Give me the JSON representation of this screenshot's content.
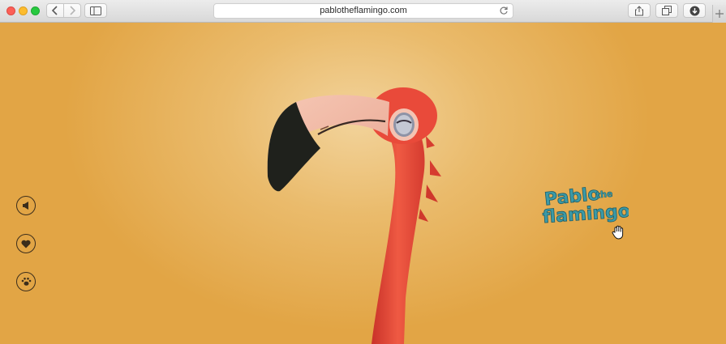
{
  "browser": {
    "url": "pablotheflamingo.com",
    "buttons": {
      "back": "back-icon",
      "forward": "forward-icon",
      "sidebar": "sidebar-icon",
      "reload": "reload-icon",
      "share": "share-icon",
      "tabs": "tabs-icon",
      "downloads": "download-icon",
      "new_tab": "plus-icon"
    }
  },
  "page": {
    "logo": {
      "line1": "Pablo",
      "small": "the",
      "line2": "flamingo"
    },
    "side_buttons": [
      "sound-icon",
      "heart-icon",
      "paw-icon"
    ]
  },
  "colors": {
    "background": "#e6ad4f",
    "flamingo": "#e8473a",
    "beak_tip": "#1f211c",
    "logo": "#3b9aa7"
  }
}
